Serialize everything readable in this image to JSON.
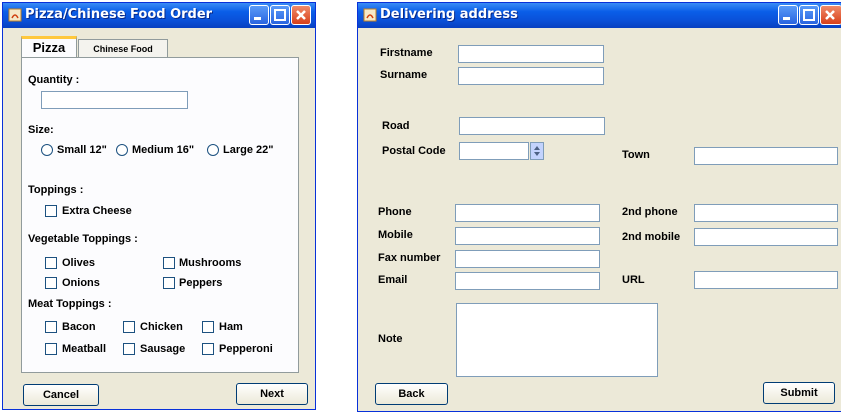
{
  "order_window": {
    "title": "Pizza/Chinese Food Order",
    "tabs": [
      "Pizza",
      "Chinese Food"
    ],
    "quantity_label": "Quantity :",
    "quantity_value": "",
    "size_label": "Size:",
    "sizes": [
      "Small 12\"",
      "Medium 16\"",
      "Large 22\""
    ],
    "toppings_label": "Toppings :",
    "extra_cheese": "Extra Cheese",
    "veg_label": "Vegetable Toppings :",
    "veg": [
      "Olives",
      "Mushrooms",
      "Onions",
      "Peppers"
    ],
    "meat_label": "Meat Toppings :",
    "meat": [
      "Bacon",
      "Chicken",
      "Ham",
      "Meatball",
      "Sausage",
      "Pepperoni"
    ],
    "cancel": "Cancel",
    "next": "Next"
  },
  "address_window": {
    "title": "Delivering address",
    "firstname": "Firstname",
    "surname": "Surname",
    "road": "Road",
    "postal_code": "Postal Code",
    "town": "Town",
    "phone": "Phone",
    "phone2": "2nd phone",
    "mobile": "Mobile",
    "mobile2": "2nd mobile",
    "fax": "Fax number",
    "email": "Email",
    "url": "URL",
    "note": "Note",
    "back": "Back",
    "submit": "Submit"
  },
  "colors": {
    "titlebar": "#0a50d8",
    "window_bg": "#ece9d8",
    "field_border": "#7f9db9",
    "close_button": "#d8401a"
  }
}
